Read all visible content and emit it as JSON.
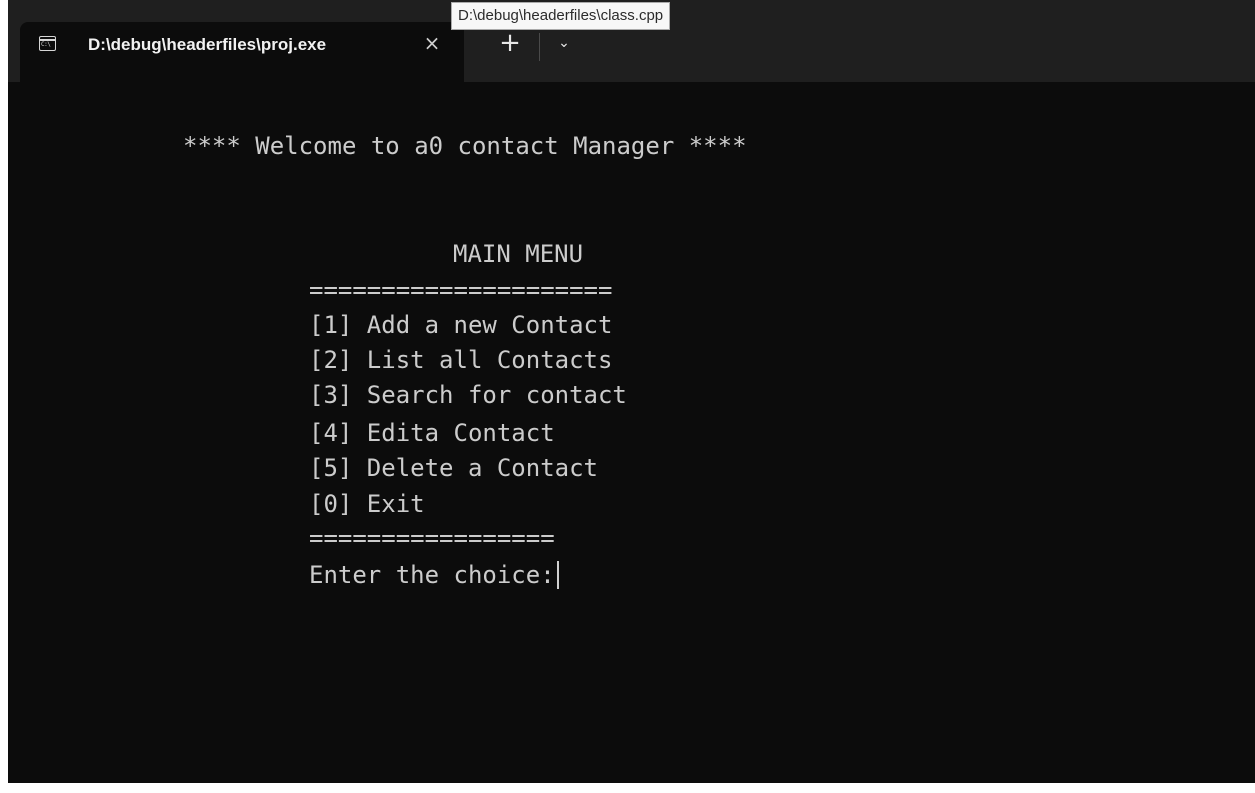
{
  "tooltip": "D:\\debug\\headerfiles\\class.cpp",
  "tab": {
    "icon_label": "C:\\",
    "title": "D:\\debug\\headerfiles\\proj.exe",
    "close": "×"
  },
  "new_tab": "+",
  "dropdown": "⌄",
  "console": {
    "welcome": "**** Welcome to a0 contact Manager ****",
    "menu_title": "MAIN MENU",
    "separator_top": "=====================",
    "items": [
      "[1] Add a new Contact",
      "[2] List all Contacts",
      "[3] Search for contact",
      "[4] Edita Contact",
      "[5] Delete a Contact",
      "[0] Exit"
    ],
    "separator_bottom": "=================",
    "prompt": "Enter the choice:"
  }
}
